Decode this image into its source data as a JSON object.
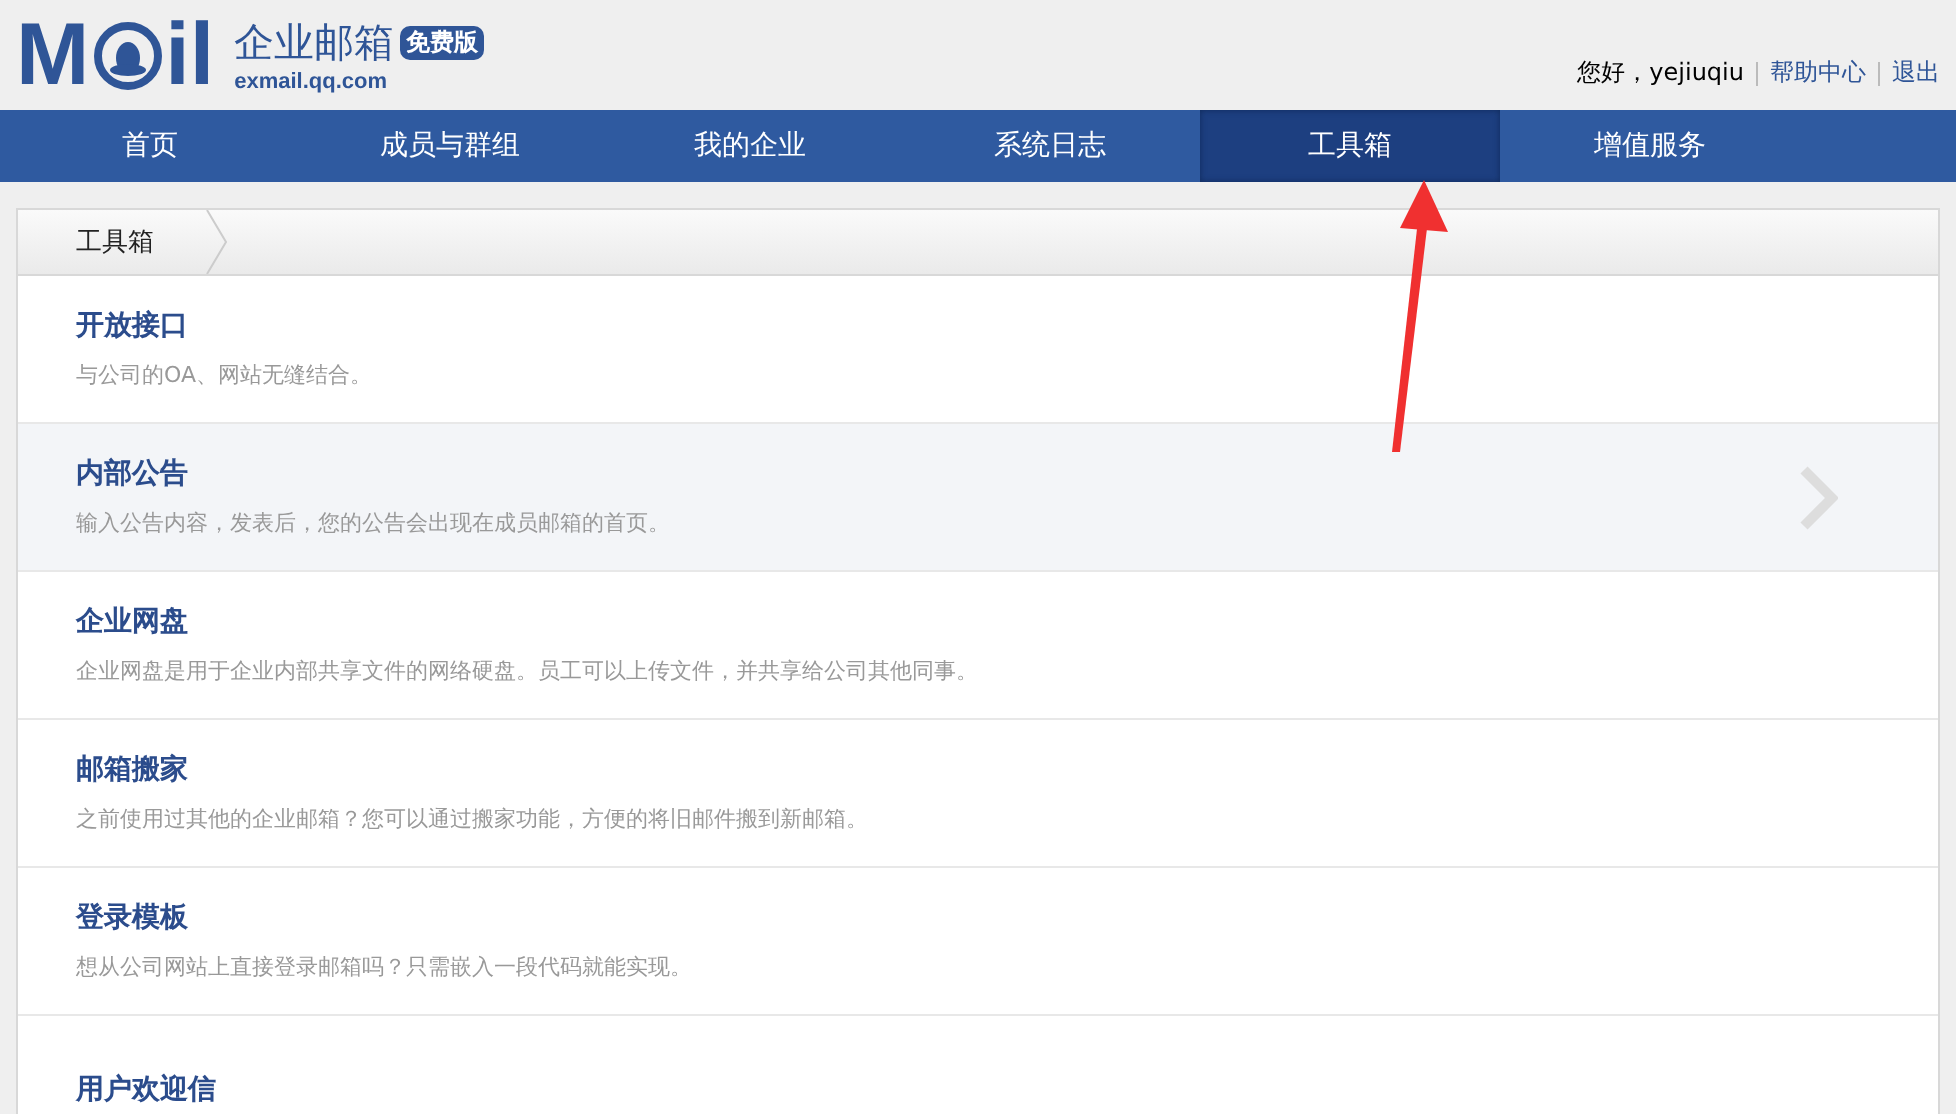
{
  "header": {
    "logo_left": "M",
    "logo_right": "il",
    "product": "企业邮箱",
    "badge": "免费版",
    "domain": "exmail.qq.com",
    "greeting": "您好，yejiuqiu",
    "links": [
      "帮助中心",
      "退出"
    ]
  },
  "nav": [
    {
      "label": "首页",
      "selected": false
    },
    {
      "label": "成员与群组",
      "selected": false
    },
    {
      "label": "我的企业",
      "selected": false
    },
    {
      "label": "系统日志",
      "selected": false
    },
    {
      "label": "工具箱",
      "selected": true
    },
    {
      "label": "增值服务",
      "selected": false
    }
  ],
  "breadcrumb": "工具箱",
  "tools": [
    {
      "title": "开放接口",
      "description": "与公司的OA、网站无缝结合。",
      "highlighted": false
    },
    {
      "title": "内部公告",
      "description": "输入公告内容，发表后，您的公告会出现在成员邮箱的首页。",
      "highlighted": true
    },
    {
      "title": "企业网盘",
      "description": "企业网盘是用于企业内部共享文件的网络硬盘。员工可以上传文件，并共享给公司其他同事。",
      "highlighted": false
    },
    {
      "title": "邮箱搬家",
      "description": "之前使用过其他的企业邮箱？您可以通过搬家功能，方便的将旧邮件搬到新邮箱。",
      "highlighted": false
    },
    {
      "title": "登录模板",
      "description": "想从公司网站上直接登录邮箱吗？只需嵌入一段代码就能实现。",
      "highlighted": false
    },
    {
      "title": "用户欢迎信",
      "highlighted": false
    }
  ]
}
